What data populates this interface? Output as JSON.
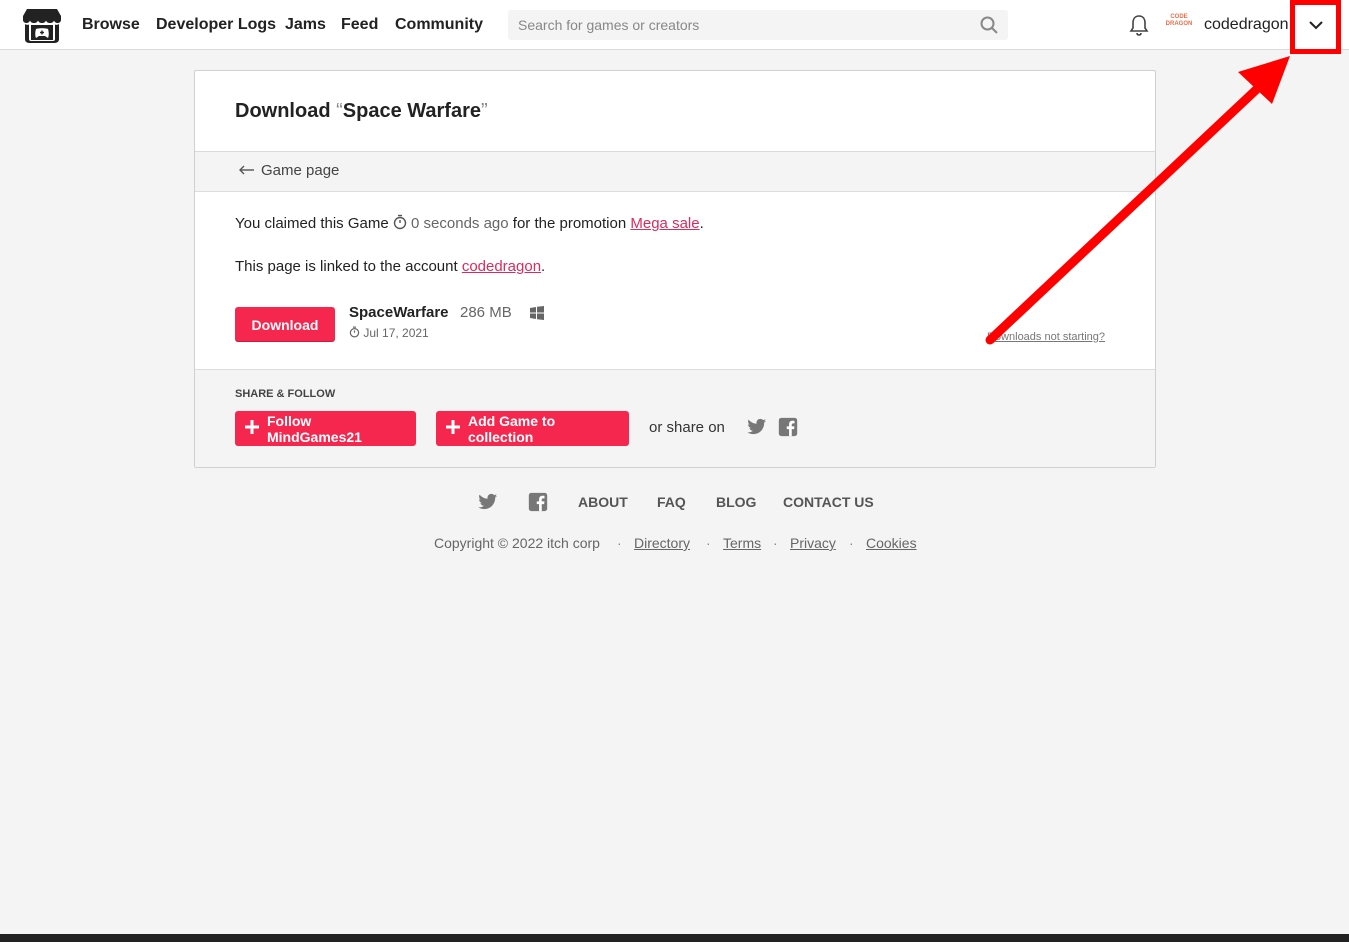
{
  "header": {
    "nav": [
      "Browse",
      "Developer Logs",
      "Jams",
      "Feed",
      "Community"
    ],
    "search_placeholder": "Search for games or creators",
    "avatar_text": "CODE DRAGON",
    "username": "codedragon"
  },
  "download": {
    "title_prefix": "Download",
    "open_quote": "“",
    "game_title": "Space Warfare",
    "close_quote": "”",
    "back_label": "Game page",
    "claimed_prefix": "You claimed this Game",
    "claimed_time": "0 seconds ago",
    "promotion_prefix": "for the promotion",
    "promotion_link": "Mega sale",
    "period": ".",
    "linked_prefix": "This page is linked to the account",
    "linked_account": "codedragon",
    "download_button": "Download",
    "file_name": "SpaceWarfare",
    "file_size": "286 MB",
    "file_date": "Jul 17, 2021",
    "not_starting": "Downloads not starting?"
  },
  "share": {
    "title": "SHARE & FOLLOW",
    "follow_button": "Follow MindGames21",
    "collection_button": "Add Game to collection",
    "or_share": "or share on"
  },
  "footer": {
    "links": [
      "ABOUT",
      "FAQ",
      "BLOG",
      "CONTACT US"
    ],
    "copyright": "Copyright © 2022 itch corp",
    "legal": [
      "Directory",
      "Terms",
      "Privacy",
      "Cookies"
    ],
    "separator": "·"
  },
  "colors": {
    "accent": "#f5274e",
    "link": "#da2c5b",
    "annotation": "#ff0000"
  }
}
